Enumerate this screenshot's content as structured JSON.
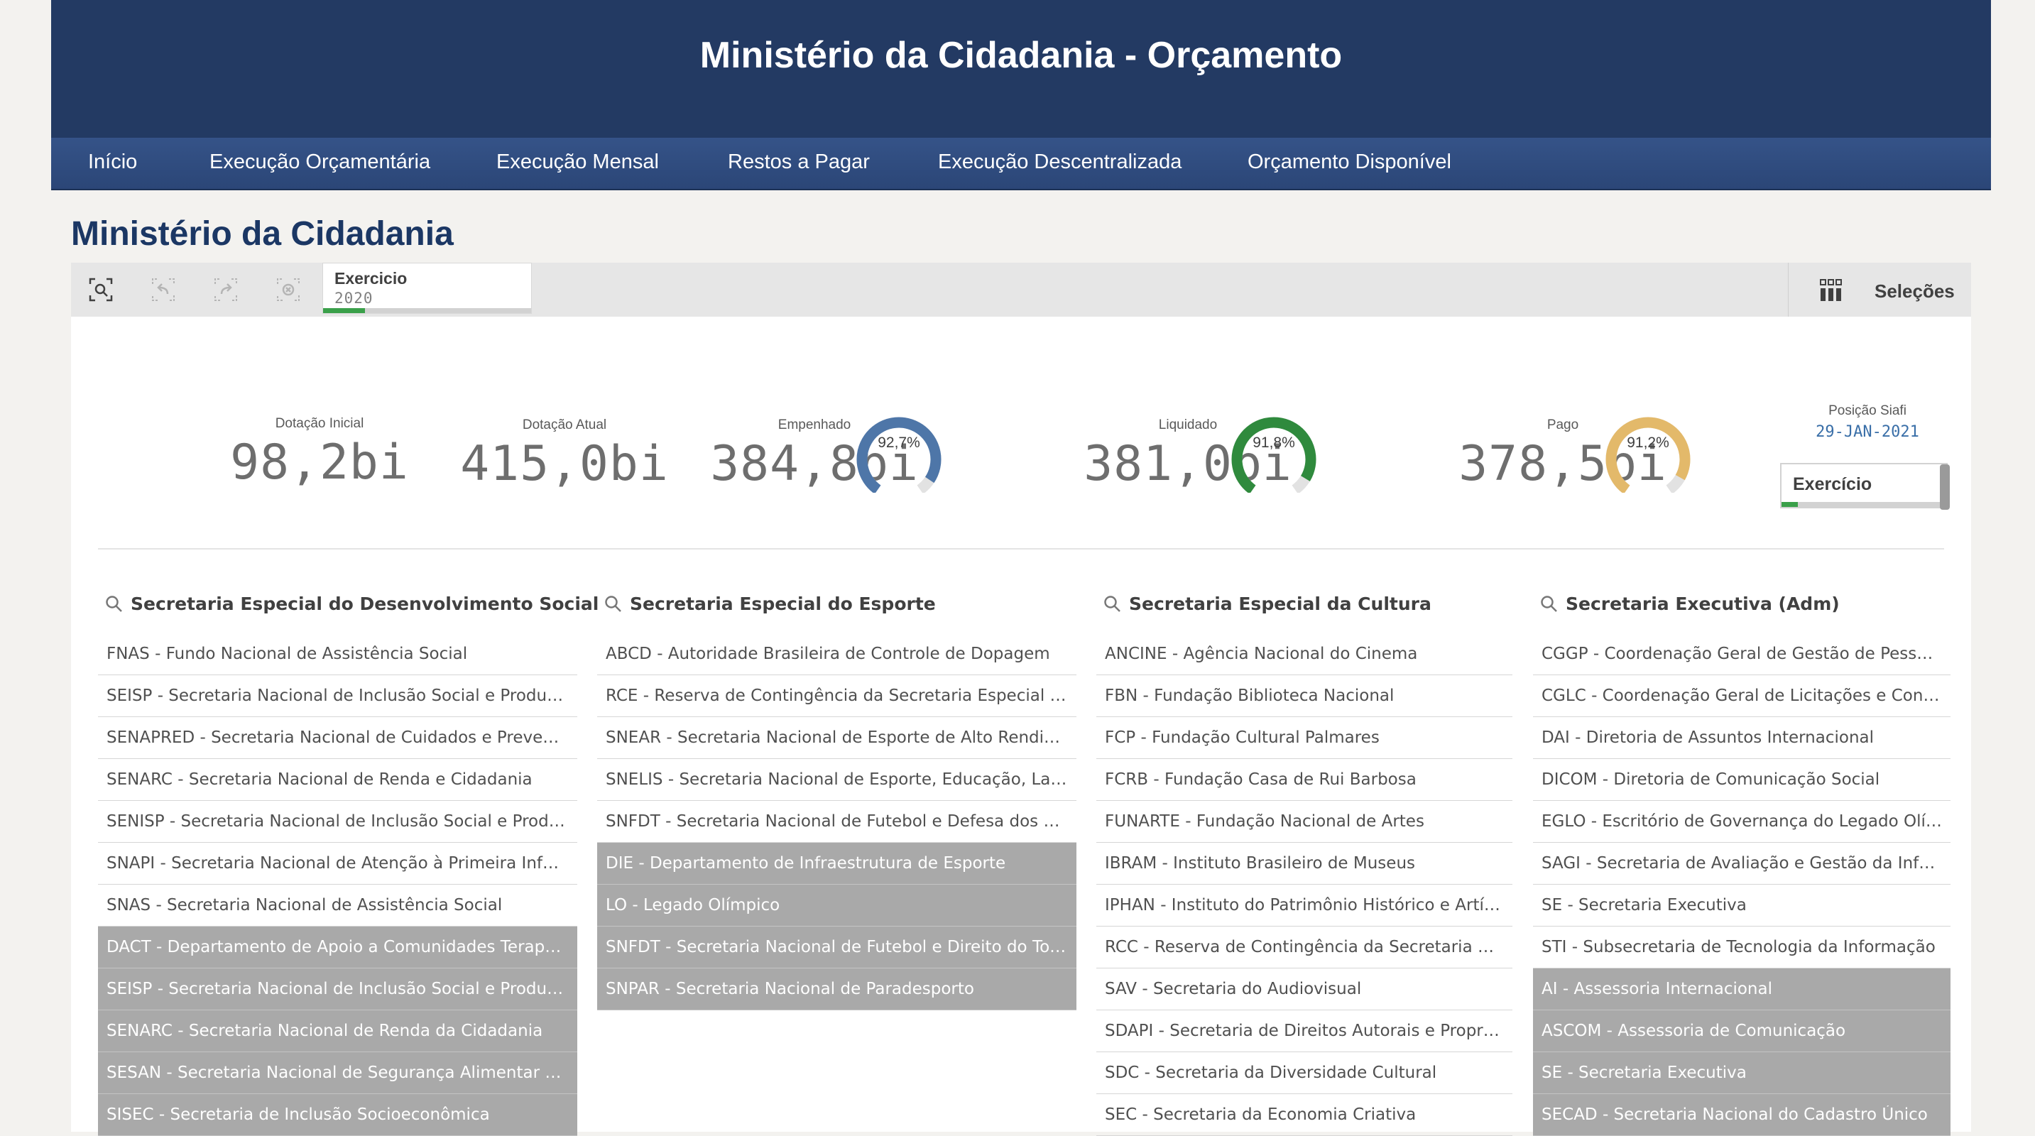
{
  "header": {
    "title": "Ministério da Cidadania - Orçamento"
  },
  "nav": {
    "items": [
      "Início",
      "Execução Orçamentária",
      "Execução Mensal",
      "Restos a Pagar",
      "Execução Descentralizada",
      "Orçamento Disponível"
    ]
  },
  "page": {
    "title": "Ministério da Cidadania"
  },
  "toolbar": {
    "buttons": [
      "smart-search-icon",
      "step-back-icon",
      "step-forward-icon",
      "clear-selections-icon"
    ],
    "selection": {
      "label": "Exercicio",
      "value": "2020",
      "fill_fraction": 0.2
    },
    "selections_label": "Seleções"
  },
  "kpis": [
    {
      "label": "Dotação Inicial",
      "value": "98,2bi"
    },
    {
      "label": "Dotação Atual",
      "value": "415,0bi"
    },
    {
      "label": "Empenhado",
      "value": "384,8bi",
      "gauge_text": "92,7%",
      "gauge_fraction": 0.927,
      "gauge_color": "#4e76a8"
    },
    {
      "label": "Liquidado",
      "value": "381,0bi",
      "gauge_text": "91,8%",
      "gauge_fraction": 0.918,
      "gauge_color": "#2f8a3d"
    },
    {
      "label": "Pago",
      "value": "378,5bi",
      "gauge_text": "91,2%",
      "gauge_fraction": 0.912,
      "gauge_color": "#e3b96a"
    }
  ],
  "siafi": {
    "label": "Posição Siafi",
    "date": "29-JAN-2021",
    "filter_label": "Exercício",
    "filter_fill_fraction": 0.1
  },
  "listboxes": [
    {
      "title": "Secretaria Especial do Desenvolvimento Social",
      "rows": [
        {
          "text": "FNAS - Fundo Nacional de Assistência Social",
          "state": "possible"
        },
        {
          "text": "SEISP - Secretaria Nacional de Inclusão Social e Produtiva",
          "state": "possible"
        },
        {
          "text": "SENAPRED - Secretaria Nacional de Cuidados e Prevençã...",
          "state": "possible"
        },
        {
          "text": "SENARC - Secretaria Nacional de Renda e Cidadania",
          "state": "possible"
        },
        {
          "text": "SENISP - Secretaria Nacional de Inclusão Social e Produti...",
          "state": "possible"
        },
        {
          "text": "SNAPI - Secretaria Nacional de Atenção à Primeira Infância",
          "state": "possible"
        },
        {
          "text": "SNAS - Secretaria Nacional de Assistência Social",
          "state": "possible"
        },
        {
          "text": "DACT - Departamento de Apoio a Comunidades Terapêuti...",
          "state": "excluded"
        },
        {
          "text": "SEISP - Secretaria Nacional de Inclusão Social e Produçã...",
          "state": "excluded"
        },
        {
          "text": "SENARC - Secretaria Nacional de Renda da Cidadania",
          "state": "excluded"
        },
        {
          "text": "SESAN - Secretaria Nacional de Segurança Alimentar e Nu...",
          "state": "excluded"
        },
        {
          "text": "SISEC - Secretaria de Inclusão Socioeconômica",
          "state": "excluded"
        }
      ]
    },
    {
      "title": "Secretaria Especial do Esporte",
      "rows": [
        {
          "text": "ABCD - Autoridade Brasileira de Controle de Dopagem",
          "state": "possible"
        },
        {
          "text": "RCE - Reserva de Contingência da Secretaria Especial do ...",
          "state": "possible"
        },
        {
          "text": "SNEAR - Secretaria Nacional de Esporte de Alto Rendime...",
          "state": "possible"
        },
        {
          "text": "SNELIS - Secretaria Nacional de Esporte, Educação, Lazer...",
          "state": "possible"
        },
        {
          "text": "SNFDT - Secretaria Nacional de Futebol e Defesa dos Direi...",
          "state": "possible"
        },
        {
          "text": "DIE - Departamento de Infraestrutura de Esporte",
          "state": "excluded"
        },
        {
          "text": "LO - Legado Olímpico",
          "state": "excluded"
        },
        {
          "text": "SNFDT - Secretaria Nacional de Futebol e Direito do Torce...",
          "state": "excluded"
        },
        {
          "text": "SNPAR - Secretaria Nacional de Paradesporto",
          "state": "excluded"
        }
      ]
    },
    {
      "title": "Secretaria Especial da Cultura",
      "rows": [
        {
          "text": "ANCINE - Agência Nacional do Cinema",
          "state": "possible"
        },
        {
          "text": "FBN - Fundação Biblioteca Nacional",
          "state": "possible"
        },
        {
          "text": "FCP - Fundação Cultural Palmares",
          "state": "possible"
        },
        {
          "text": "FCRB - Fundação Casa de Rui Barbosa",
          "state": "possible"
        },
        {
          "text": "FUNARTE - Fundação Nacional de Artes",
          "state": "possible"
        },
        {
          "text": "IBRAM - Instituto Brasileiro de Museus",
          "state": "possible"
        },
        {
          "text": "IPHAN - Instituto do Patrimônio Histórico e Artís...",
          "state": "possible"
        },
        {
          "text": "RCC - Reserva de Contingência da Secretaria Esp...",
          "state": "possible"
        },
        {
          "text": "SAV - Secretaria do Audiovisual",
          "state": "possible"
        },
        {
          "text": "SDAPI - Secretaria de Direitos Autorais e Proprie...",
          "state": "possible"
        },
        {
          "text": "SDC - Secretaria da Diversidade Cultural",
          "state": "possible"
        },
        {
          "text": "SEC - Secretaria da Economia Criativa",
          "state": "possible"
        }
      ]
    },
    {
      "title": "Secretaria Executiva (Adm)",
      "rows": [
        {
          "text": "CGGP - Coordenação Geral de Gestão de Pessoas",
          "state": "possible"
        },
        {
          "text": "CGLC - Coordenação Geral de Licitações e Contra...",
          "state": "possible"
        },
        {
          "text": "DAI - Diretoria de Assuntos Internacional",
          "state": "possible"
        },
        {
          "text": "DICOM - Diretoria de Comunicação Social",
          "state": "possible"
        },
        {
          "text": "EGLO - Escritório de Governança do Legado Olím...",
          "state": "possible"
        },
        {
          "text": "SAGI - Secretaria de Avaliação e Gestão da Infor...",
          "state": "possible"
        },
        {
          "text": "SE - Secretaria Executiva",
          "state": "possible"
        },
        {
          "text": "STI - Subsecretaria de Tecnologia da Informação",
          "state": "possible"
        },
        {
          "text": "AI - Assessoria Internacional",
          "state": "excluded"
        },
        {
          "text": "ASCOM - Assessoria de Comunicação",
          "state": "excluded"
        },
        {
          "text": "SE - Secretaria Executiva",
          "state": "excluded"
        },
        {
          "text": "SECAD - Secretaria Nacional do Cadastro Único",
          "state": "excluded"
        }
      ]
    }
  ]
}
